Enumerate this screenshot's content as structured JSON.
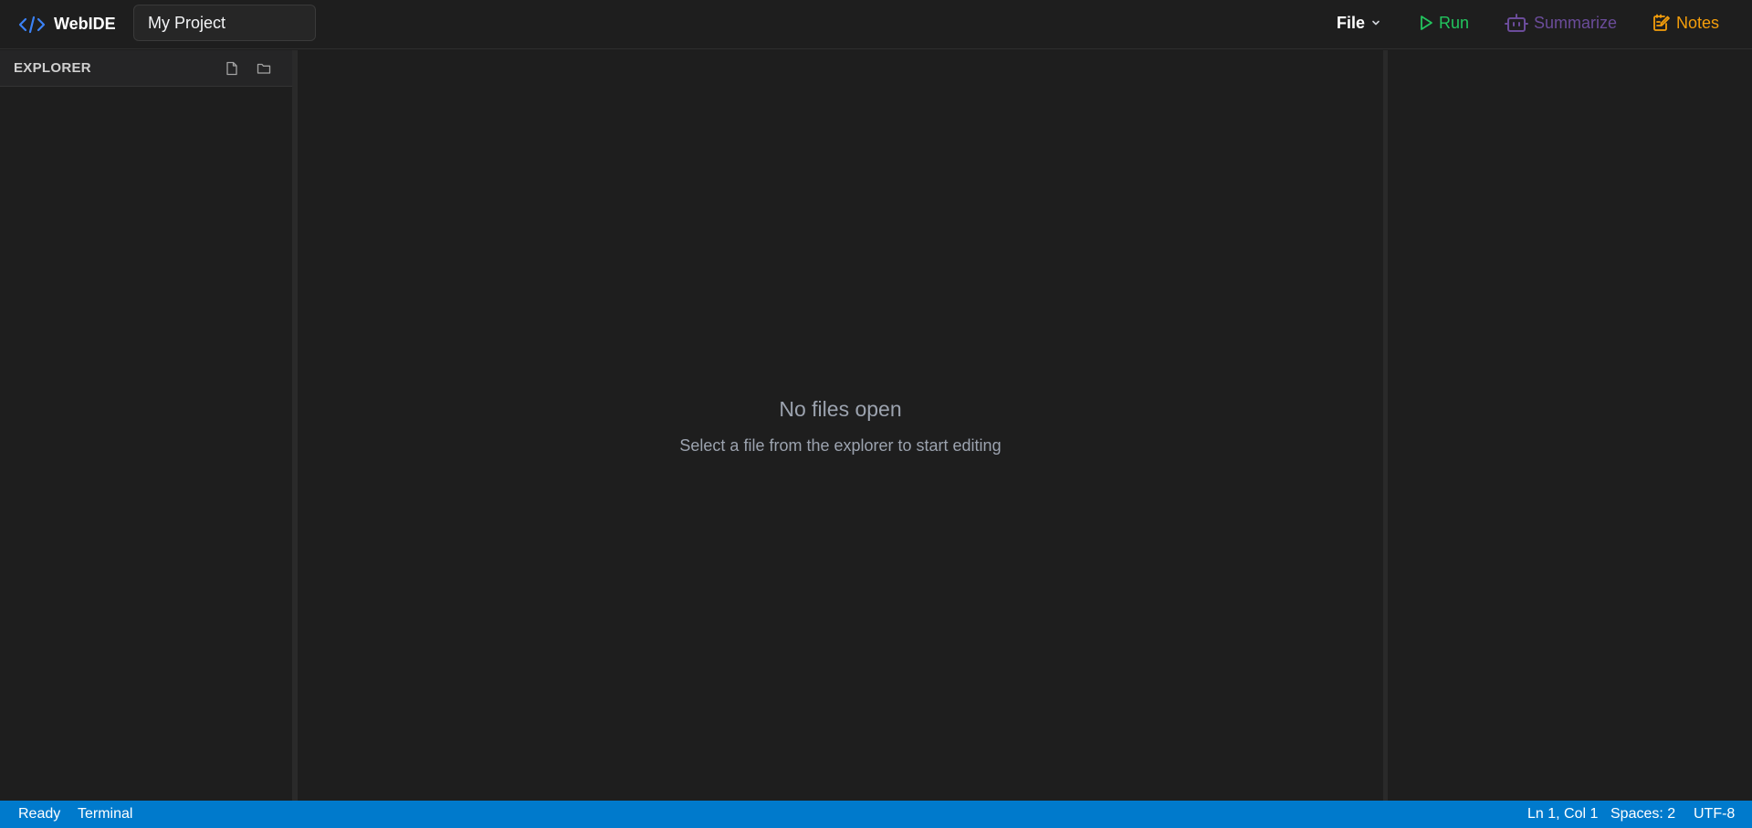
{
  "header": {
    "brand": "WebIDE",
    "project_name": "My Project",
    "file_menu": "File",
    "run": "Run",
    "summarize": "Summarize",
    "notes": "Notes"
  },
  "sidebar": {
    "title": "EXPLORER",
    "actions": [
      "new-file-icon",
      "new-folder-icon"
    ]
  },
  "editor": {
    "empty_title": "No files open",
    "empty_subtitle": "Select a file from the explorer to start editing"
  },
  "statusbar": {
    "status": "Ready",
    "terminal": "Terminal",
    "position": "Ln 1, Col 1",
    "spaces": "Spaces: 2",
    "encoding": "UTF-8"
  },
  "colors": {
    "run": "#22c55e",
    "summarize": "#6b4c9a",
    "notes": "#f59e0b",
    "brand_icon": "#3b82f6",
    "statusbar": "#007acc"
  }
}
